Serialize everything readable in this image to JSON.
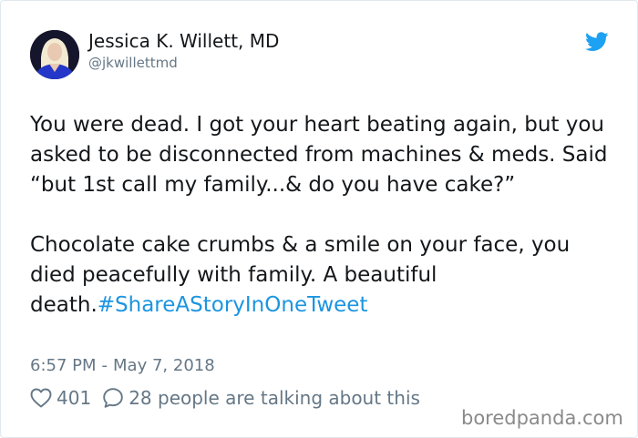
{
  "author": {
    "name": "Jessica K. Willett, MD",
    "handle": "@jkwillettmd"
  },
  "tweet": {
    "paragraph1": "You were dead. I got your heart beating again, but you asked to be disconnected from machines & meds. Said “but 1st call my family...& do you have cake?”",
    "paragraph2_text": "Chocolate cake crumbs & a smile on your face, you died peacefully with family. A beautiful death.",
    "hashtag": "#ShareAStoryInOneTweet"
  },
  "meta": {
    "time": "6:57 PM",
    "separator": "-",
    "date": "May 7, 2018"
  },
  "stats": {
    "likes": "401",
    "conversation": "28 people are talking about this"
  },
  "watermark": "boredpanda.com",
  "colors": {
    "text": "#14171a",
    "secondary": "#657786",
    "hashtag": "#1b95e0",
    "twitter_blue": "#1da1f2"
  },
  "icons": {
    "brand": "twitter-bird-icon",
    "like": "heart-icon",
    "reply": "speech-bubble-icon"
  }
}
